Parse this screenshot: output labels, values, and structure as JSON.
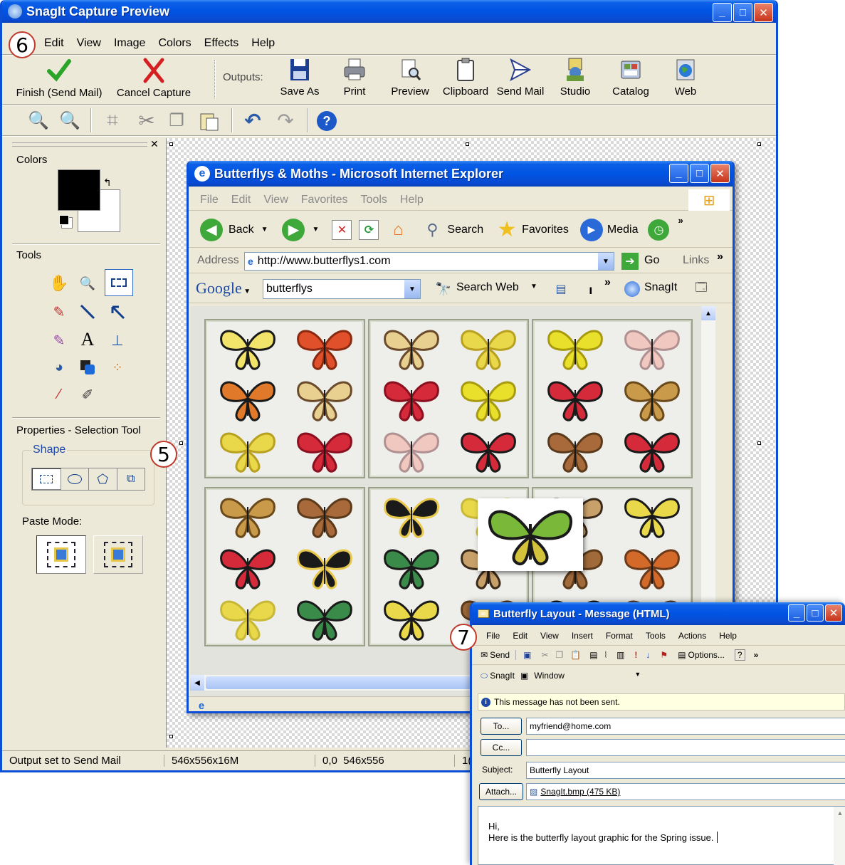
{
  "snagit": {
    "title": "SnagIt Capture Preview",
    "menu": [
      "Edit",
      "View",
      "Image",
      "Colors",
      "Effects",
      "Help"
    ],
    "toolbar": {
      "finish_label": "Finish (Send Mail)",
      "cancel_label": "Cancel Capture",
      "outputs_label": "Outputs:",
      "outputs": [
        "Save As",
        "Print",
        "Preview",
        "Clipboard",
        "Send Mail",
        "Studio",
        "Catalog",
        "Web"
      ]
    },
    "panel": {
      "colors_label": "Colors",
      "tools_label": "Tools",
      "properties_label": "Properties - Selection Tool",
      "shape_label": "Shape",
      "paste_mode_label": "Paste Mode:"
    },
    "status": {
      "output": "Output set to Send Mail",
      "size": "546x556x16M",
      "coords": "0,0  546x556",
      "extra": "1("
    },
    "colors": {
      "title_blue": "#0054e3",
      "chrome": "#ece9d8",
      "callout_red": "#c0392b"
    }
  },
  "ie": {
    "title": "Butterflys & Moths - Microsoft Internet Explorer",
    "menu": [
      "File",
      "Edit",
      "View",
      "Favorites",
      "Tools",
      "Help"
    ],
    "toolbar": {
      "back": "Back",
      "search": "Search",
      "favorites": "Favorites",
      "media": "Media"
    },
    "address_label": "Address",
    "address_value": "http://www.butterflys1.com",
    "go_label": "Go",
    "links_label": "Links",
    "google_logo": "Google",
    "google_query": "butterflys",
    "search_web": "Search Web",
    "snagit_btn": "SnagIt"
  },
  "outlook": {
    "title": "Butterfly Layout - Message (HTML)",
    "menu": [
      "File",
      "Edit",
      "View",
      "Insert",
      "Format",
      "Tools",
      "Actions",
      "Help"
    ],
    "send_label": "Send",
    "options_label": "Options...",
    "snagit_label": "SnagIt",
    "window_label": "Window",
    "notice": "This message has not been sent.",
    "to_label": "To...",
    "to_value": "myfriend@home.com",
    "cc_label": "Cc...",
    "cc_value": "",
    "subject_label": "Subject:",
    "subject_value": "Butterfly Layout",
    "attach_label": "Attach...",
    "attach_value": "SnagIt.bmp (475 KB)",
    "body_line1": "Hi,",
    "body_line2": "Here is the butterfly layout graphic for the Spring issue."
  },
  "callouts": [
    "5",
    "6",
    "7"
  ]
}
